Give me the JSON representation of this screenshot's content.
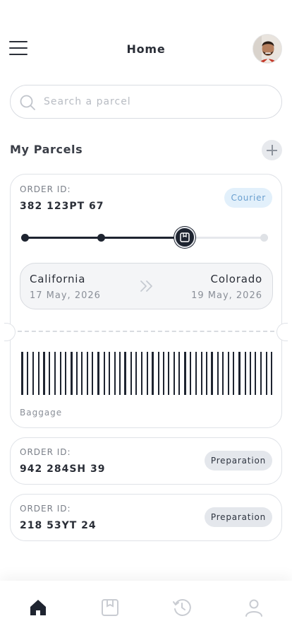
{
  "header": {
    "title": "Home",
    "menu_icon": "hamburger-menu-icon",
    "avatar": "user-avatar"
  },
  "search": {
    "placeholder": "Search a parcel",
    "icon": "search-icon"
  },
  "section": {
    "title": "My Parcels",
    "add_icon": "plus-icon"
  },
  "parcels": [
    {
      "order_label": "ORDER ID:",
      "order_id": "382 123PT 67",
      "status": "Courier",
      "progress_step": 3,
      "progress_total": 4,
      "from_city": "California",
      "from_date": "17 May, 2026",
      "to_city": "Colorado",
      "to_date": "19 May, 2026",
      "barcode_label": "Baggage"
    },
    {
      "order_label": "ORDER ID:",
      "order_id": "942 284SH 39",
      "status": "Preparation"
    },
    {
      "order_label": "ORDER ID:",
      "order_id": "218 53YT 24",
      "status": "Preparation"
    }
  ],
  "bottom_nav": {
    "items": [
      "home-icon",
      "package-icon",
      "history-icon",
      "profile-icon"
    ],
    "active": "home-icon"
  },
  "colors": {
    "accent": "#1e2430",
    "courier_badge_bg": "#e2f0fb",
    "courier_badge_text": "#6a9fcf",
    "preparation_badge_bg": "#e4e7ec"
  }
}
